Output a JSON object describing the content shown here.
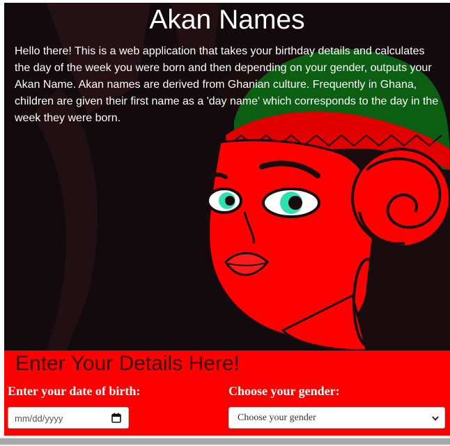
{
  "header": {
    "title": "Akan Names",
    "intro": "Hello there! This is a web application that takes your birthday details and calculates the day of the week you were born and then depending on your gender, outputs your Akan Name. Akan names are derived from Ghanian culture. Frequently in Ghana, children are given their first name as a 'day name' which corresponds to the day in the week they were born."
  },
  "form": {
    "heading": "Enter Your Details Here!",
    "dob_label": "Enter your date of birth:",
    "dob_placeholder": "mm/dd/yyyy",
    "gender_label": "Choose your gender:",
    "gender_selected": "Choose your gender"
  },
  "icons": {
    "date": "calendar-icon",
    "select": "chevron-down-icon"
  },
  "colors": {
    "hero_bg": "#120a0c",
    "face": "#ff0000",
    "form_bg": "#ff0000",
    "headwrap_green": "#0b5e12",
    "eye": "#2ee0b0"
  }
}
